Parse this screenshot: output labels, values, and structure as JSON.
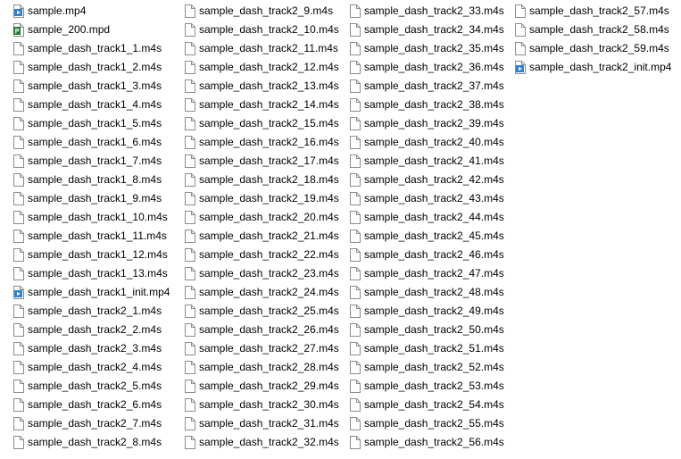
{
  "icon_colors": {
    "page_border": "#8c8c8c",
    "page_fill": "#ffffff",
    "mp4_badge": "#2a86d8",
    "mpd_badge": "#1e7b34"
  },
  "columns": [
    {
      "files": [
        {
          "name": "sample.mp4",
          "icon": "mp4-video-file-icon"
        },
        {
          "name": "sample_200.mpd",
          "icon": "mpd-manifest-file-icon"
        },
        {
          "name": "sample_dash_track1_1.m4s",
          "icon": "blank-file-icon"
        },
        {
          "name": "sample_dash_track1_2.m4s",
          "icon": "blank-file-icon"
        },
        {
          "name": "sample_dash_track1_3.m4s",
          "icon": "blank-file-icon"
        },
        {
          "name": "sample_dash_track1_4.m4s",
          "icon": "blank-file-icon"
        },
        {
          "name": "sample_dash_track1_5.m4s",
          "icon": "blank-file-icon"
        },
        {
          "name": "sample_dash_track1_6.m4s",
          "icon": "blank-file-icon"
        },
        {
          "name": "sample_dash_track1_7.m4s",
          "icon": "blank-file-icon"
        },
        {
          "name": "sample_dash_track1_8.m4s",
          "icon": "blank-file-icon"
        },
        {
          "name": "sample_dash_track1_9.m4s",
          "icon": "blank-file-icon"
        },
        {
          "name": "sample_dash_track1_10.m4s",
          "icon": "blank-file-icon"
        },
        {
          "name": "sample_dash_track1_11.m4s",
          "icon": "blank-file-icon"
        },
        {
          "name": "sample_dash_track1_12.m4s",
          "icon": "blank-file-icon"
        },
        {
          "name": "sample_dash_track1_13.m4s",
          "icon": "blank-file-icon"
        },
        {
          "name": "sample_dash_track1_init.mp4",
          "icon": "mp4-video-file-icon"
        },
        {
          "name": "sample_dash_track2_1.m4s",
          "icon": "blank-file-icon"
        },
        {
          "name": "sample_dash_track2_2.m4s",
          "icon": "blank-file-icon"
        },
        {
          "name": "sample_dash_track2_3.m4s",
          "icon": "blank-file-icon"
        },
        {
          "name": "sample_dash_track2_4.m4s",
          "icon": "blank-file-icon"
        },
        {
          "name": "sample_dash_track2_5.m4s",
          "icon": "blank-file-icon"
        },
        {
          "name": "sample_dash_track2_6.m4s",
          "icon": "blank-file-icon"
        },
        {
          "name": "sample_dash_track2_7.m4s",
          "icon": "blank-file-icon"
        },
        {
          "name": "sample_dash_track2_8.m4s",
          "icon": "blank-file-icon"
        }
      ]
    },
    {
      "files": [
        {
          "name": "sample_dash_track2_9.m4s",
          "icon": "blank-file-icon"
        },
        {
          "name": "sample_dash_track2_10.m4s",
          "icon": "blank-file-icon"
        },
        {
          "name": "sample_dash_track2_11.m4s",
          "icon": "blank-file-icon"
        },
        {
          "name": "sample_dash_track2_12.m4s",
          "icon": "blank-file-icon"
        },
        {
          "name": "sample_dash_track2_13.m4s",
          "icon": "blank-file-icon"
        },
        {
          "name": "sample_dash_track2_14.m4s",
          "icon": "blank-file-icon"
        },
        {
          "name": "sample_dash_track2_15.m4s",
          "icon": "blank-file-icon"
        },
        {
          "name": "sample_dash_track2_16.m4s",
          "icon": "blank-file-icon"
        },
        {
          "name": "sample_dash_track2_17.m4s",
          "icon": "blank-file-icon"
        },
        {
          "name": "sample_dash_track2_18.m4s",
          "icon": "blank-file-icon"
        },
        {
          "name": "sample_dash_track2_19.m4s",
          "icon": "blank-file-icon"
        },
        {
          "name": "sample_dash_track2_20.m4s",
          "icon": "blank-file-icon"
        },
        {
          "name": "sample_dash_track2_21.m4s",
          "icon": "blank-file-icon"
        },
        {
          "name": "sample_dash_track2_22.m4s",
          "icon": "blank-file-icon"
        },
        {
          "name": "sample_dash_track2_23.m4s",
          "icon": "blank-file-icon"
        },
        {
          "name": "sample_dash_track2_24.m4s",
          "icon": "blank-file-icon"
        },
        {
          "name": "sample_dash_track2_25.m4s",
          "icon": "blank-file-icon"
        },
        {
          "name": "sample_dash_track2_26.m4s",
          "icon": "blank-file-icon"
        },
        {
          "name": "sample_dash_track2_27.m4s",
          "icon": "blank-file-icon"
        },
        {
          "name": "sample_dash_track2_28.m4s",
          "icon": "blank-file-icon"
        },
        {
          "name": "sample_dash_track2_29.m4s",
          "icon": "blank-file-icon"
        },
        {
          "name": "sample_dash_track2_30.m4s",
          "icon": "blank-file-icon"
        },
        {
          "name": "sample_dash_track2_31.m4s",
          "icon": "blank-file-icon"
        },
        {
          "name": "sample_dash_track2_32.m4s",
          "icon": "blank-file-icon"
        }
      ]
    },
    {
      "files": [
        {
          "name": "sample_dash_track2_33.m4s",
          "icon": "blank-file-icon"
        },
        {
          "name": "sample_dash_track2_34.m4s",
          "icon": "blank-file-icon"
        },
        {
          "name": "sample_dash_track2_35.m4s",
          "icon": "blank-file-icon"
        },
        {
          "name": "sample_dash_track2_36.m4s",
          "icon": "blank-file-icon"
        },
        {
          "name": "sample_dash_track2_37.m4s",
          "icon": "blank-file-icon"
        },
        {
          "name": "sample_dash_track2_38.m4s",
          "icon": "blank-file-icon"
        },
        {
          "name": "sample_dash_track2_39.m4s",
          "icon": "blank-file-icon"
        },
        {
          "name": "sample_dash_track2_40.m4s",
          "icon": "blank-file-icon"
        },
        {
          "name": "sample_dash_track2_41.m4s",
          "icon": "blank-file-icon"
        },
        {
          "name": "sample_dash_track2_42.m4s",
          "icon": "blank-file-icon"
        },
        {
          "name": "sample_dash_track2_43.m4s",
          "icon": "blank-file-icon"
        },
        {
          "name": "sample_dash_track2_44.m4s",
          "icon": "blank-file-icon"
        },
        {
          "name": "sample_dash_track2_45.m4s",
          "icon": "blank-file-icon"
        },
        {
          "name": "sample_dash_track2_46.m4s",
          "icon": "blank-file-icon"
        },
        {
          "name": "sample_dash_track2_47.m4s",
          "icon": "blank-file-icon"
        },
        {
          "name": "sample_dash_track2_48.m4s",
          "icon": "blank-file-icon"
        },
        {
          "name": "sample_dash_track2_49.m4s",
          "icon": "blank-file-icon"
        },
        {
          "name": "sample_dash_track2_50.m4s",
          "icon": "blank-file-icon"
        },
        {
          "name": "sample_dash_track2_51.m4s",
          "icon": "blank-file-icon"
        },
        {
          "name": "sample_dash_track2_52.m4s",
          "icon": "blank-file-icon"
        },
        {
          "name": "sample_dash_track2_53.m4s",
          "icon": "blank-file-icon"
        },
        {
          "name": "sample_dash_track2_54.m4s",
          "icon": "blank-file-icon"
        },
        {
          "name": "sample_dash_track2_55.m4s",
          "icon": "blank-file-icon"
        },
        {
          "name": "sample_dash_track2_56.m4s",
          "icon": "blank-file-icon"
        }
      ]
    },
    {
      "files": [
        {
          "name": "sample_dash_track2_57.m4s",
          "icon": "blank-file-icon"
        },
        {
          "name": "sample_dash_track2_58.m4s",
          "icon": "blank-file-icon"
        },
        {
          "name": "sample_dash_track2_59.m4s",
          "icon": "blank-file-icon"
        },
        {
          "name": "sample_dash_track2_init.mp4",
          "icon": "mp4-video-file-icon"
        }
      ]
    }
  ]
}
